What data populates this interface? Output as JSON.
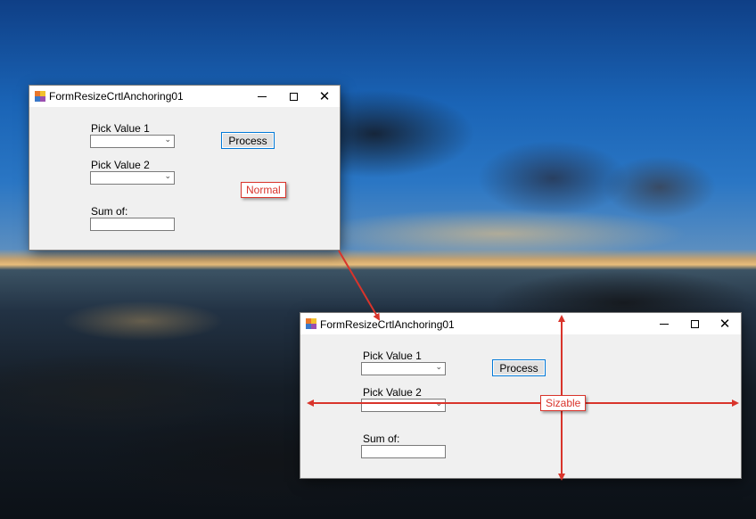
{
  "windows": [
    {
      "id": "normal",
      "title": "FormResizeCrtlAnchoring01",
      "pick_value_1_label": "Pick Value 1",
      "pick_value_2_label": "Pick Value 2",
      "process_button_label": "Process",
      "sum_label": "Sum of:",
      "annotation": "Normal"
    },
    {
      "id": "sizable",
      "title": "FormResizeCrtlAnchoring01",
      "pick_value_1_label": "Pick Value 1",
      "pick_value_2_label": "Pick Value 2",
      "process_button_label": "Process",
      "sum_label": "Sum of:",
      "annotation": "Sizable"
    }
  ],
  "caption_buttons": {
    "minimize_icon": "minimize-icon",
    "maximize_icon": "maximize-icon",
    "close_icon": "close-icon"
  },
  "colors": {
    "annotation_red": "#d9342b",
    "focus_blue": "#0078d7",
    "form_background": "#f0f0f0"
  }
}
